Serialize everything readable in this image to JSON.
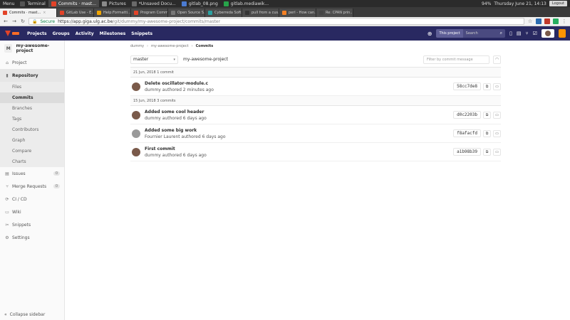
{
  "os_bar": {
    "menu_label": "Menu",
    "items": [
      {
        "label": "Terminal",
        "color": "#555555"
      },
      {
        "label": "Commits · mast...",
        "color": "#e24329",
        "active": true
      },
      {
        "label": "Pictures",
        "color": "#8a8a8a"
      },
      {
        "label": "*Unsaved Docu...",
        "color": "#6a6a6a"
      },
      {
        "label": "gitlab_08.png",
        "color": "#4b7bd1"
      },
      {
        "label": "gitlab.mediawik...",
        "color": "#27a34a"
      }
    ],
    "battery": "94%",
    "datetime": "Thursday June 21, 14:13",
    "logout": "Logout"
  },
  "tabs": [
    {
      "label": "Commits · mast...",
      "color": "#e24329",
      "active": true
    },
    {
      "label": "GitLab Use - E...",
      "color": "#e24329"
    },
    {
      "label": "Help:Formatti...",
      "color": "#f0a500"
    },
    {
      "label": "Program Comm...",
      "color": "#e24329"
    },
    {
      "label": "Open Source S...",
      "color": "#777777"
    },
    {
      "label": "Cyberreda Soft...",
      "color": "#2aa1a1"
    },
    {
      "label": "pull from a cus...",
      "color": "#333333"
    },
    {
      "label": "perl - How can...",
      "color": "#f48024"
    },
    {
      "label": "Re: CPAN prin...",
      "color": "#444444"
    }
  ],
  "address": {
    "secure_label": "Secure",
    "host": "https://app.giga.ulg.ac.be",
    "path": "/git/dummy/my-awesome-project/commits/master"
  },
  "gl_header": {
    "nav": [
      "Projects",
      "Groups",
      "Activity",
      "Milestones",
      "Snippets"
    ],
    "search_scope": "This project",
    "search_placeholder": "Search"
  },
  "sidebar": {
    "project_initial": "M",
    "project_name": "my-awesome-project",
    "items": [
      {
        "label": "Project",
        "icon": "house-icon"
      },
      {
        "label": "Repository",
        "icon": "book-icon",
        "active": true
      },
      {
        "label": "Issues",
        "icon": "issues-icon",
        "badge": "0"
      },
      {
        "label": "Merge Requests",
        "icon": "merge-icon",
        "badge": "0"
      },
      {
        "label": "CI / CD",
        "icon": "rocket-icon"
      },
      {
        "label": "Wiki",
        "icon": "wiki-icon"
      },
      {
        "label": "Snippets",
        "icon": "scissors-icon"
      },
      {
        "label": "Settings",
        "icon": "gear-icon"
      }
    ],
    "repo_sub": [
      "Files",
      "Commits",
      "Branches",
      "Tags",
      "Contributors",
      "Graph",
      "Compare",
      "Charts"
    ],
    "collapse_label": "Collapse sidebar"
  },
  "main": {
    "breadcrumbs": [
      "dummy",
      "my-awesome-project",
      "Commits"
    ],
    "branch": "master",
    "path": "my-awesome-project",
    "filter_placeholder": "Filter by commit message",
    "days": [
      {
        "header": "21 Jun, 2018 1 commit",
        "commits": [
          {
            "title": "Delete oscillator-module.c",
            "meta": "dummy authored 2 minutes ago",
            "sha": "58cc7de8",
            "avatar_color": "#7a5a4a"
          }
        ]
      },
      {
        "header": "15 Jun, 2018 3 commits",
        "commits": [
          {
            "title": "Added some cool header",
            "meta": "dummy authored 6 days ago",
            "sha": "d0c2203b",
            "avatar_color": "#7a5a4a"
          },
          {
            "title": "Added some big work",
            "meta": "Fournier Laurent authored 6 days ago",
            "sha": "f8afacfd",
            "avatar_color": "#9a9a9a"
          },
          {
            "title": "First commit",
            "meta": "dummy authored 6 days ago",
            "sha": "a1b98b39",
            "avatar_color": "#7a5a4a"
          }
        ]
      }
    ]
  }
}
